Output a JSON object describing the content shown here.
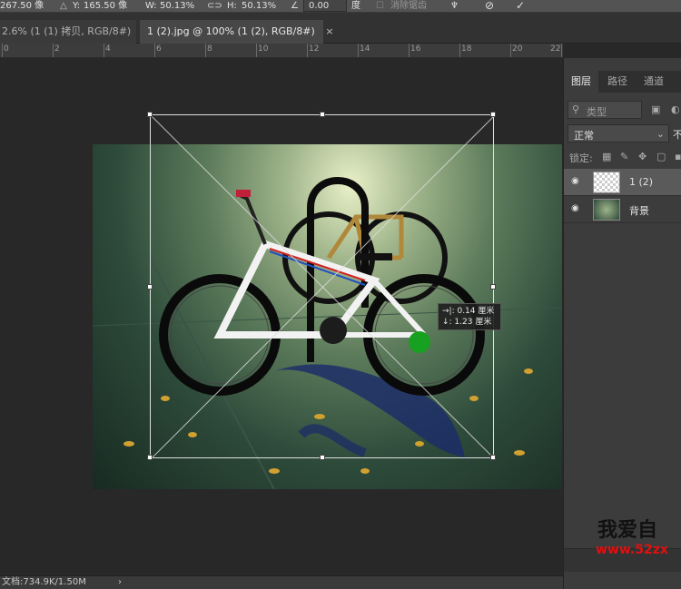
{
  "options_bar": {
    "x_value": "267.50 像",
    "y_label": "Y:",
    "y_value": "165.50 像",
    "w_label": "W:",
    "w_value": "50.13%",
    "h_label": "H:",
    "h_value": "50.13%",
    "angle_value": "0.00",
    "angle_unit": "度",
    "antialias_label": "消除锯齿"
  },
  "tabs": [
    {
      "label": "2.6% (1 (1) 拷贝, RGB/8#)",
      "close": "×"
    },
    {
      "label": "1 (2).jpg @ 100% (1 (2), RGB/8#)",
      "close": "×"
    }
  ],
  "ruler": {
    "labels": [
      "0",
      "2",
      "4",
      "6",
      "8",
      "10",
      "12",
      "14",
      "16",
      "18",
      "20",
      "22"
    ]
  },
  "tooltip": {
    "line1": "→|: 0.14 厘米",
    "line2": "↓: 1.23 厘米"
  },
  "status": {
    "text": "文档:734.9K/1.50M",
    "arrow": "›"
  },
  "panel": {
    "tabs": [
      "图层",
      "路径",
      "通道"
    ],
    "filter_placeholder": "类型",
    "blend_mode": "正常",
    "opacity_label": "不",
    "lock_label": "锁定:",
    "layers": [
      {
        "name": "1 (2)",
        "selected": true
      },
      {
        "name": "背景",
        "selected": false
      }
    ]
  },
  "watermark": {
    "top": "我爱自",
    "url": "www.52zx"
  },
  "colors": {
    "accent": "#e01010",
    "panel_bg": "#3c3c3c",
    "canvas_bg": "#282828"
  }
}
